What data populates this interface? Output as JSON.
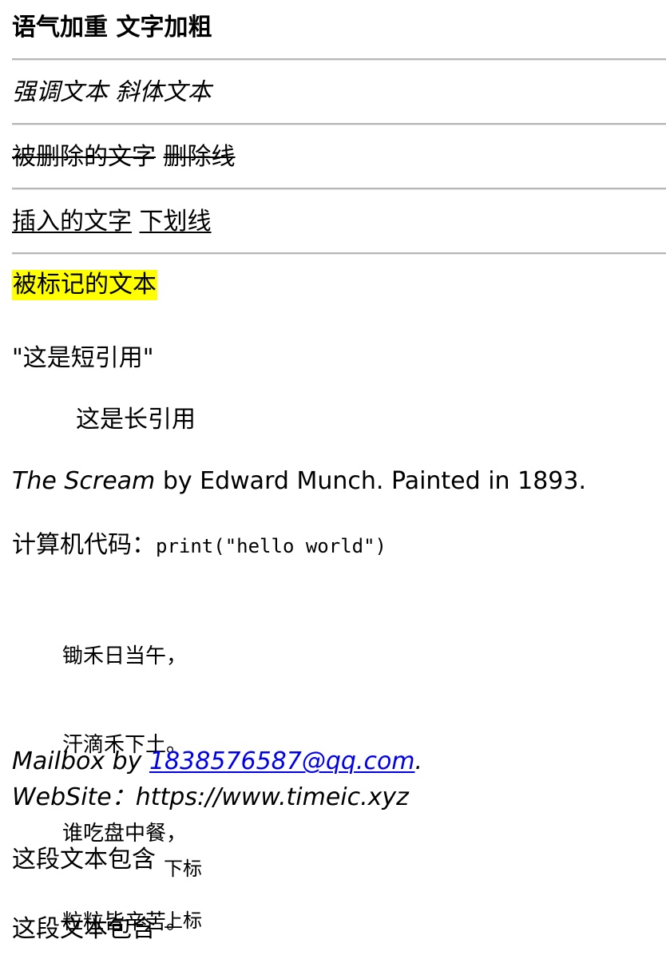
{
  "lines": {
    "bold": {
      "strong": "语气加重",
      "b": "文字加粗"
    },
    "italic": {
      "em": "强调文本",
      "i": "斜体文本"
    },
    "strike": {
      "del": "被删除的文字",
      "s": "删除线"
    },
    "underline": {
      "ins": "插入的文字",
      "u": "下划线"
    },
    "mark": "被标记的文本",
    "short_quote": "\"这是短引用\"",
    "long_quote": "这是长引用",
    "cite": {
      "title": "The Scream",
      "rest": " by Edward Munch. Painted in 1893."
    },
    "code": {
      "label": "计算机代码：",
      "value": "print(\"hello world\")"
    },
    "poem": [
      "锄禾日当午，",
      "汗滴禾下土。",
      "谁吃盘中餐，",
      "粒粒皆辛苦。"
    ],
    "address": {
      "prefix": "Mailbox by ",
      "email": "1838576587@qq.com",
      "email_suffix": ".",
      "website": "WebSite：https://www.timeic.xyz"
    },
    "subscript": {
      "text": "这段文本包含",
      "sub": "下标"
    },
    "superscript": {
      "text": "这段文本包含",
      "sup": "上标"
    }
  }
}
